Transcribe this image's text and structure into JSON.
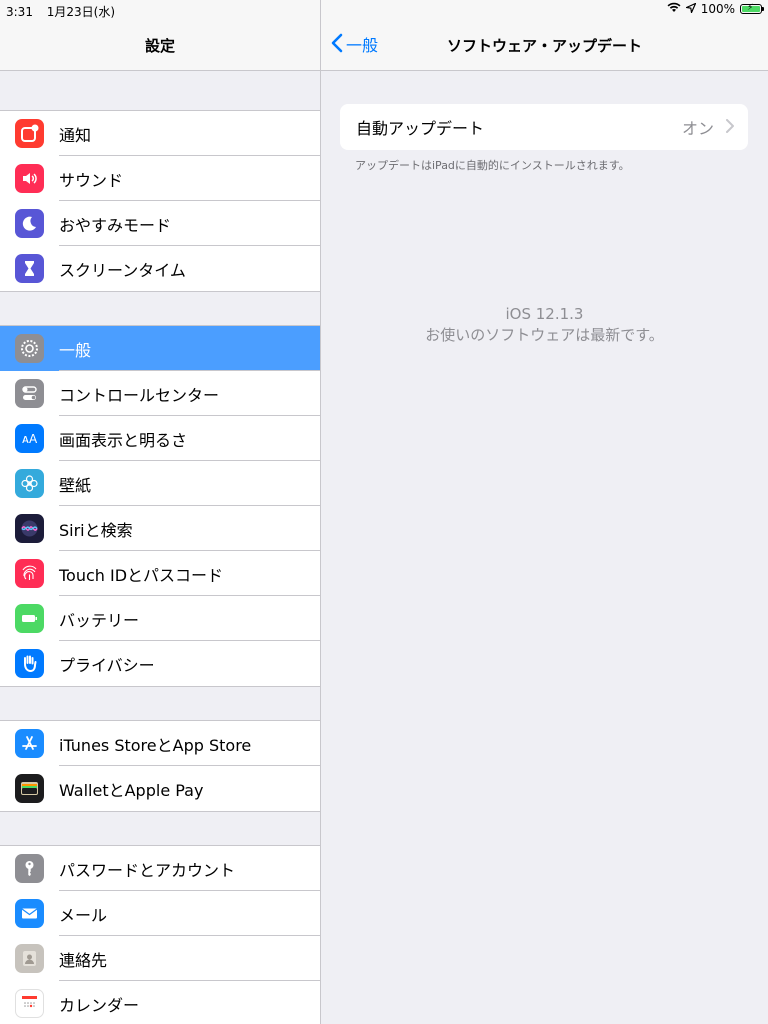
{
  "status_bar": {
    "time": "3:31",
    "date": "1月23日(水)",
    "battery": "100%"
  },
  "sidebar": {
    "title": "設定",
    "groups": [
      {
        "items": [
          {
            "label": "通知",
            "icon": "notifications-icon",
            "color": "#ff3b30"
          },
          {
            "label": "サウンド",
            "icon": "sounds-icon",
            "color": "#ff2d55"
          },
          {
            "label": "おやすみモード",
            "icon": "moon-icon",
            "color": "#5856d6"
          },
          {
            "label": "スクリーンタイム",
            "icon": "hourglass-icon",
            "color": "#5856d6"
          }
        ]
      },
      {
        "items": [
          {
            "label": "一般",
            "icon": "gear-icon",
            "color": "#8e8e93",
            "selected": true
          },
          {
            "label": "コントロールセンター",
            "icon": "toggles-icon",
            "color": "#8e8e93"
          },
          {
            "label": "画面表示と明るさ",
            "icon": "text-size-icon",
            "color": "#007aff"
          },
          {
            "label": "壁紙",
            "icon": "flower-icon",
            "color": "#34aadc"
          },
          {
            "label": "Siriと検索",
            "icon": "siri-icon",
            "color": "#1c1c3a"
          },
          {
            "label": "Touch IDとパスコード",
            "icon": "fingerprint-icon",
            "color": "#ff2d55"
          },
          {
            "label": "バッテリー",
            "icon": "battery-icon",
            "color": "#4cd964"
          },
          {
            "label": "プライバシー",
            "icon": "hand-icon",
            "color": "#007aff"
          }
        ]
      },
      {
        "items": [
          {
            "label": "iTunes StoreとApp Store",
            "icon": "app-store-icon",
            "color": "#1a8cff"
          },
          {
            "label": "WalletとApple Pay",
            "icon": "wallet-icon",
            "color": "#1c1c1e"
          }
        ]
      },
      {
        "items": [
          {
            "label": "パスワードとアカウント",
            "icon": "key-icon",
            "color": "#8e8e93"
          },
          {
            "label": "メール",
            "icon": "mail-icon",
            "color": "#1a8cff"
          },
          {
            "label": "連絡先",
            "icon": "contacts-icon",
            "color": "#c7c3bd"
          },
          {
            "label": "カレンダー",
            "icon": "calendar-icon",
            "color": "#ffffff"
          }
        ]
      }
    ]
  },
  "detail": {
    "back_label": "一般",
    "title": "ソフトウェア・アップデート",
    "auto_update": {
      "label": "自動アップデート",
      "value": "オン"
    },
    "footnote": "アップデートはiPadに自動的にインストールされます。",
    "version": "iOS 12.1.3",
    "version_message": "お使いのソフトウェアは最新です。"
  },
  "colors": {
    "accent": "#007aff",
    "selected_row": "#4b9eff"
  }
}
